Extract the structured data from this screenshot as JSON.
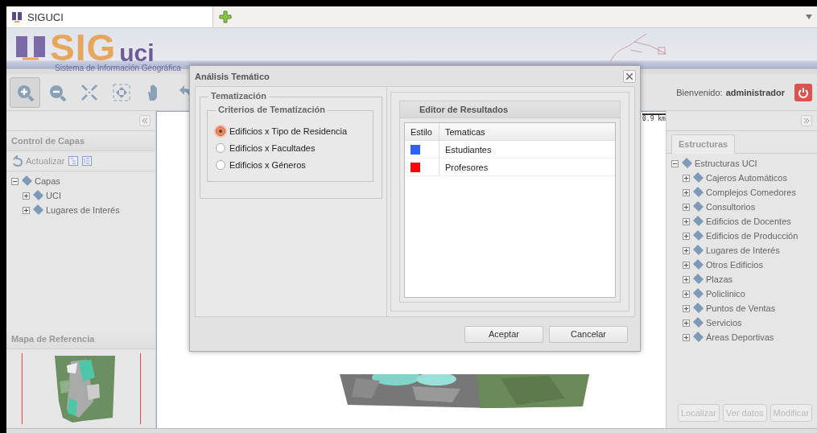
{
  "browser_tab": {
    "title": "SIGUCI"
  },
  "banner": {
    "logo_part_1": "SIG",
    "logo_part_2": "uci",
    "subtitle": "Sistema de Información Geográfica"
  },
  "toolbar": {
    "tools": [
      {
        "kind": "zoom-in",
        "selected": true
      },
      {
        "kind": "zoom-out",
        "selected": false
      },
      {
        "kind": "shrink",
        "selected": false
      },
      {
        "kind": "extent",
        "selected": false
      },
      {
        "kind": "pan",
        "selected": false
      },
      {
        "kind": "undo",
        "selected": false
      }
    ]
  },
  "user": {
    "greeting": "Bienvenido:",
    "name": "administrador"
  },
  "left_panel": {
    "title": "Control de Capas",
    "refresh_label": "Actualizar",
    "tree": [
      {
        "label": "Capas",
        "expanded": true,
        "children": [
          {
            "label": "UCI",
            "expanded": false
          },
          {
            "label": "Lugares de Interés",
            "expanded": false
          }
        ]
      }
    ],
    "reference_map_title": "Mapa de Referencia"
  },
  "map": {
    "scale": "0.9 km"
  },
  "right_panel": {
    "tabs": [
      {
        "label": "Estructuras",
        "selected": true
      }
    ],
    "tree": [
      {
        "label": "Estructuras UCI",
        "expanded": true,
        "children": [
          {
            "label": "Cajeros Automáticos",
            "expanded": false
          },
          {
            "label": "Complejos Comedores",
            "expanded": false
          },
          {
            "label": "Consultorios",
            "expanded": false
          },
          {
            "label": "Edificios de Docentes",
            "expanded": false
          },
          {
            "label": "Edificios de Producción",
            "expanded": false
          },
          {
            "label": "Lugares de Interés",
            "expanded": false
          },
          {
            "label": "Otros Edificios",
            "expanded": false
          },
          {
            "label": "Plazas",
            "expanded": false
          },
          {
            "label": "Policlinico",
            "expanded": false
          },
          {
            "label": "Puntos de Ventas",
            "expanded": false
          },
          {
            "label": "Servicios",
            "expanded": false
          },
          {
            "label": "Áreas Deportivas",
            "expanded": false
          }
        ]
      }
    ],
    "buttons": [
      {
        "label": "Localizar",
        "disabled": true
      },
      {
        "label": "Ver datos",
        "disabled": true
      },
      {
        "label": "Modificar",
        "disabled": true
      }
    ]
  },
  "dialog": {
    "title": "Análisis Temático",
    "group_title": "Tematización",
    "criteria_title": "Criterios de Tematización",
    "options": [
      {
        "label": "Edificios x Tipo de Residencia",
        "selected": true
      },
      {
        "label": "Edificios x Facultades",
        "selected": false
      },
      {
        "label": "Edificios x Géneros",
        "selected": false
      }
    ],
    "results": {
      "title": "Editor de Resultados",
      "columns": [
        "Estilo",
        "Tematicas"
      ],
      "rows": [
        {
          "color": "#2e62f5",
          "label": "Estudiantes"
        },
        {
          "color": "#ff0000",
          "label": "Profesores"
        }
      ]
    },
    "buttons": [
      "Aceptar",
      "Cancelar"
    ]
  }
}
